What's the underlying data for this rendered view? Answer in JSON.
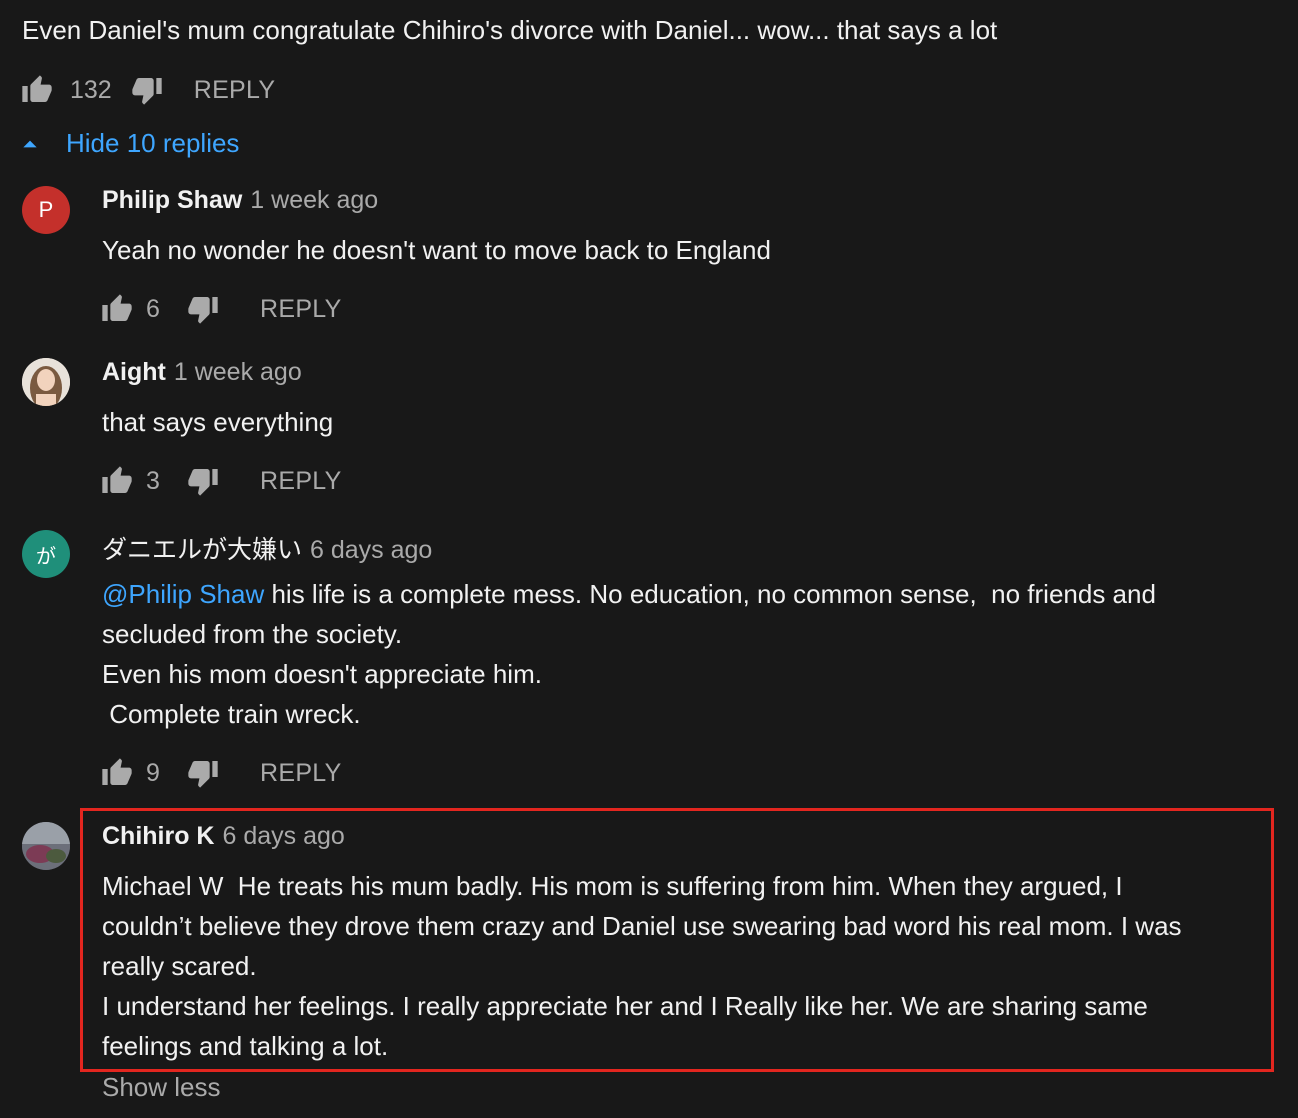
{
  "top_comment": {
    "text": "Even Daniel's mum congratulate Chihiro's divorce with Daniel... wow... that says a lot",
    "likes": "132",
    "reply_label": "REPLY"
  },
  "replies_toggle": {
    "label": "Hide 10 replies"
  },
  "replies": [
    {
      "avatar_letter": "P",
      "avatar_color": "#c4302b",
      "author": "Philip Shaw",
      "time": "1 week ago",
      "text": "Yeah no wonder he doesn't want to move back to England",
      "likes": "6",
      "reply_label": "REPLY"
    },
    {
      "avatar_letter": "",
      "author": "Aight",
      "time": "1 week ago",
      "text": "that says everything",
      "likes": "3",
      "reply_label": "REPLY"
    },
    {
      "avatar_letter": "が",
      "avatar_color": "#1f8f7a",
      "author": "ダニエルが大嫌い",
      "time": "6 days ago",
      "mention": "@Philip Shaw",
      "text": " his life is a complete mess. No education, no common sense,  no friends and\nsecluded from the society.\nEven his mom doesn't appreciate him.\n Complete train wreck.",
      "likes": "9",
      "reply_label": "REPLY"
    },
    {
      "avatar_letter": "",
      "author": "Chihiro K",
      "time": "6 days ago",
      "text": "Michael W  He treats his mum badly. His mom is suffering from him. When they argued, I\ncouldn’t believe they drove them crazy and Daniel use swearing bad word his real mom. I was\nreally scared.\nI understand her feelings. I really appreciate her and I Really like her. We are sharing same\nfeelings and talking a lot.",
      "show_less": "Show less"
    }
  ],
  "colors": {
    "background": "#181818",
    "link": "#3ea6ff",
    "highlight": "#e3261f"
  }
}
